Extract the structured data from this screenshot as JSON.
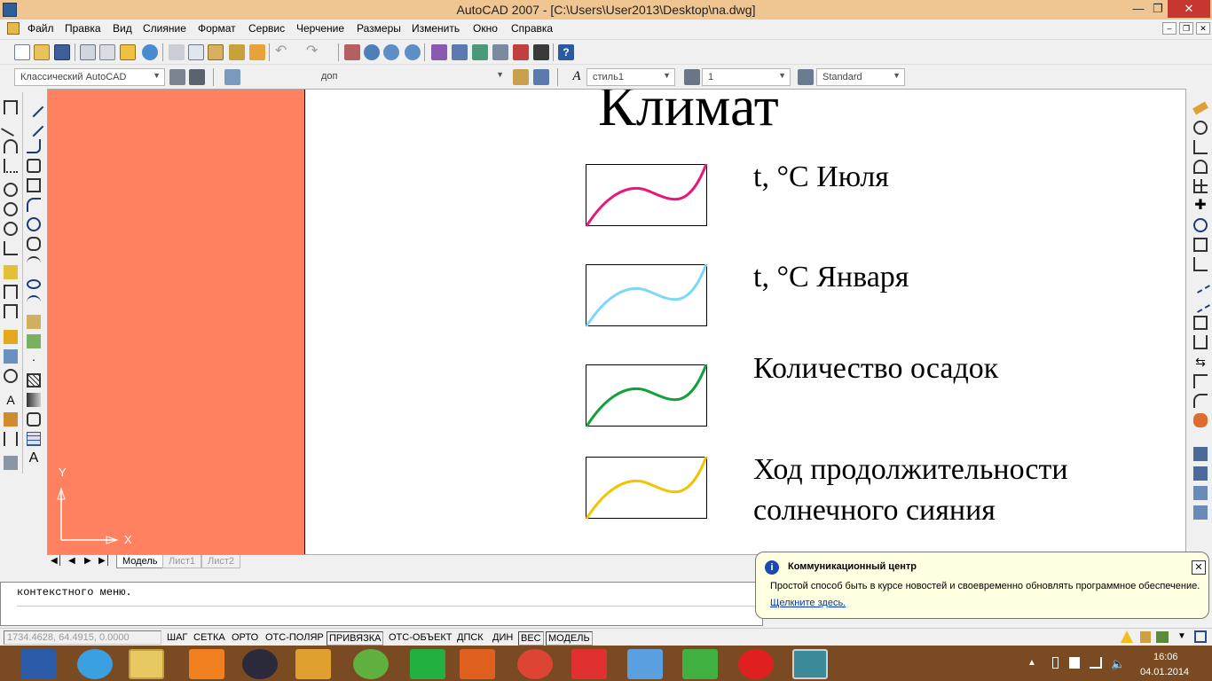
{
  "window": {
    "title": "AutoCAD 2007 - [C:\\Users\\User2013\\Desktop\\na.dwg]"
  },
  "menu": [
    "Файл",
    "Правка",
    "Вид",
    "Слияние",
    "Формат",
    "Сервис",
    "Черчение",
    "Размеры",
    "Изменить",
    "Окно",
    "Справка"
  ],
  "toolbar": {
    "workspace": "Классический AutoCAD",
    "layer": "доп",
    "textstyle": "стиль1",
    "dimscale": "1",
    "tablestyle": "Standard"
  },
  "drawing": {
    "title": "Климат",
    "legend": [
      {
        "label": "t, °C Июля",
        "color": "#e8177a"
      },
      {
        "label": "t, °C Января",
        "color": "#7dd8f5"
      },
      {
        "label": "Количество осадок",
        "color": "#12a03a"
      },
      {
        "label": "Ход продолжительности",
        "label2": "солнечного сияния",
        "color": "#f2c400"
      }
    ],
    "ucs_x": "X",
    "ucs_y": "Y"
  },
  "tabs": [
    "Модель",
    "Лист1",
    "Лист2"
  ],
  "command": {
    "line": "контекстного меню."
  },
  "balloon": {
    "title": "Коммуникационный центр",
    "body": "Простой способ быть в курсе новостей и своевременно обновлять программное обеспечение.",
    "link": "Щелкните здесь."
  },
  "status": {
    "coords": "1734.4628, 64.4915, 0.0000",
    "buttons": [
      "ШАГ",
      "СЕТКА",
      "ОРТО",
      "ОТС-ПОЛЯР",
      "ПРИВЯЗКА",
      "ОТС-ОБЪЕКТ",
      "ДПСК",
      "ДИН",
      "ВЕС",
      "МОДЕЛЬ"
    ]
  },
  "taskbar": {
    "time": "16:06",
    "date": "04.01.2014"
  },
  "colors": {
    "titlebar": "#efc691",
    "orange_panel": "#ff8160",
    "taskbar": "#7a4a22"
  }
}
